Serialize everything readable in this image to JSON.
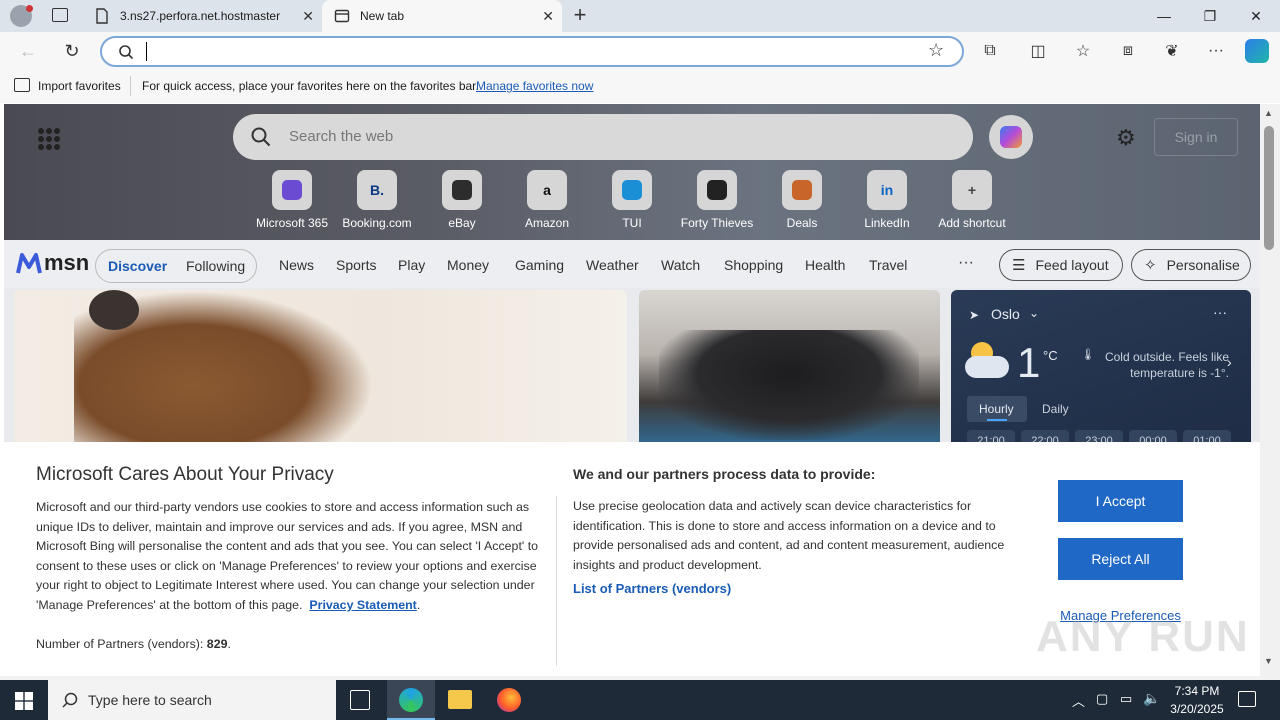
{
  "browser": {
    "tabs": [
      {
        "title": "3.ns27.perfora.net.hostmaster"
      },
      {
        "title": "New tab"
      }
    ],
    "address_value": "",
    "favorites_bar": {
      "import_label": "Import favorites",
      "hint": "For quick access, place your favorites here on the favorites bar.",
      "manage_link": "Manage favorites now"
    }
  },
  "msn": {
    "search_placeholder": "Search the web",
    "sign_in": "Sign in",
    "shortcuts": [
      {
        "label": "Microsoft 365",
        "icon": "microsoft-365-icon"
      },
      {
        "label": "Booking.com",
        "icon": "booking-icon",
        "glyph": "B."
      },
      {
        "label": "eBay",
        "icon": "ebay-icon"
      },
      {
        "label": "Amazon",
        "icon": "amazon-icon",
        "glyph": "a"
      },
      {
        "label": "TUI",
        "icon": "tui-icon"
      },
      {
        "label": "Forty Thieves",
        "icon": "swords-icon"
      },
      {
        "label": "Deals",
        "icon": "deals-icon"
      },
      {
        "label": "LinkedIn",
        "icon": "linkedin-icon",
        "glyph": "in"
      },
      {
        "label": "Add shortcut",
        "icon": "plus-icon",
        "glyph": "+"
      }
    ],
    "logo": "msn",
    "nav": {
      "discover": "Discover",
      "following": "Following",
      "items": [
        "News",
        "Sports",
        "Play",
        "Money",
        "Gaming",
        "Weather",
        "Watch",
        "Shopping",
        "Health",
        "Travel"
      ],
      "more": "···",
      "feed_layout": "Feed layout",
      "personalise": "Personalise"
    },
    "weather": {
      "location": "Oslo",
      "temp": "1",
      "unit": "°C",
      "summary": "Cold outside. Feels like temperature is -1°.",
      "tabs": [
        "Hourly",
        "Daily"
      ],
      "hours": [
        "21:00",
        "22:00",
        "23:00",
        "00:00",
        "01:00"
      ]
    }
  },
  "privacy": {
    "title": "Microsoft Cares About Your Privacy",
    "body": "Microsoft and our third-party vendors use cookies to store and access information such as unique IDs to deliver, maintain and improve our services and ads. If you agree, MSN and Microsoft Bing will personalise the content and ads that you see. You can select 'I Accept' to consent to these uses or click on 'Manage Preferences' to review your options and exercise your right to object to Legitimate Interest where used.  You can change your selection under 'Manage Preferences' at the bottom of this page.",
    "privacy_link": "Privacy Statement",
    "partners_label": "Number of Partners (vendors):",
    "partners_count": "829",
    "purposes_title": "We and our partners process data to provide:",
    "purposes_body": "Use precise geolocation data and actively scan device characteristics for identification. This is done to store and access information on a device and to provide personalised ads and content, ad and content measurement, audience insights and product development.",
    "partners_link": "List of Partners (vendors)",
    "accept": "I Accept",
    "reject": "Reject All",
    "manage": "Manage Preferences"
  },
  "taskbar": {
    "search_placeholder": "Type here to search",
    "time": "7:34 PM",
    "date": "3/20/2025"
  },
  "watermark": "ANY RUN"
}
